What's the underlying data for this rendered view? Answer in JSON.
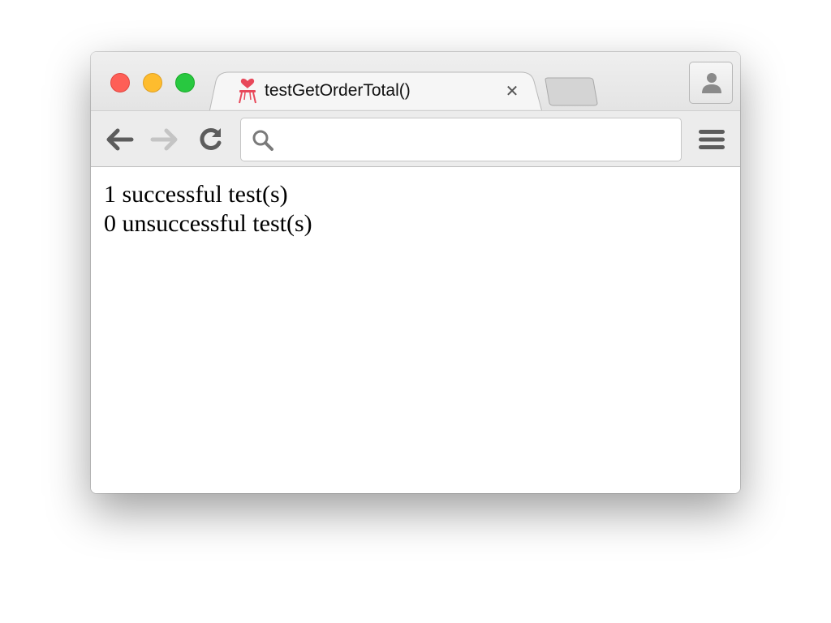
{
  "window": {
    "tab": {
      "title": "testGetOrderTotal()",
      "favicon": "stool-heart-icon",
      "close_glyph": "✕"
    },
    "controls": {
      "close_color": "#fe5f57",
      "minimize_color": "#febc2e",
      "maximize_color": "#28c840"
    }
  },
  "toolbar": {
    "back_icon": "arrow-left-icon",
    "forward_icon": "arrow-right-icon",
    "reload_icon": "reload-icon",
    "menu_icon": "hamburger-menu-icon",
    "address": {
      "value": "",
      "placeholder": ""
    }
  },
  "content": {
    "lines": [
      "1 successful test(s)",
      "0 unsuccessful test(s)"
    ]
  }
}
